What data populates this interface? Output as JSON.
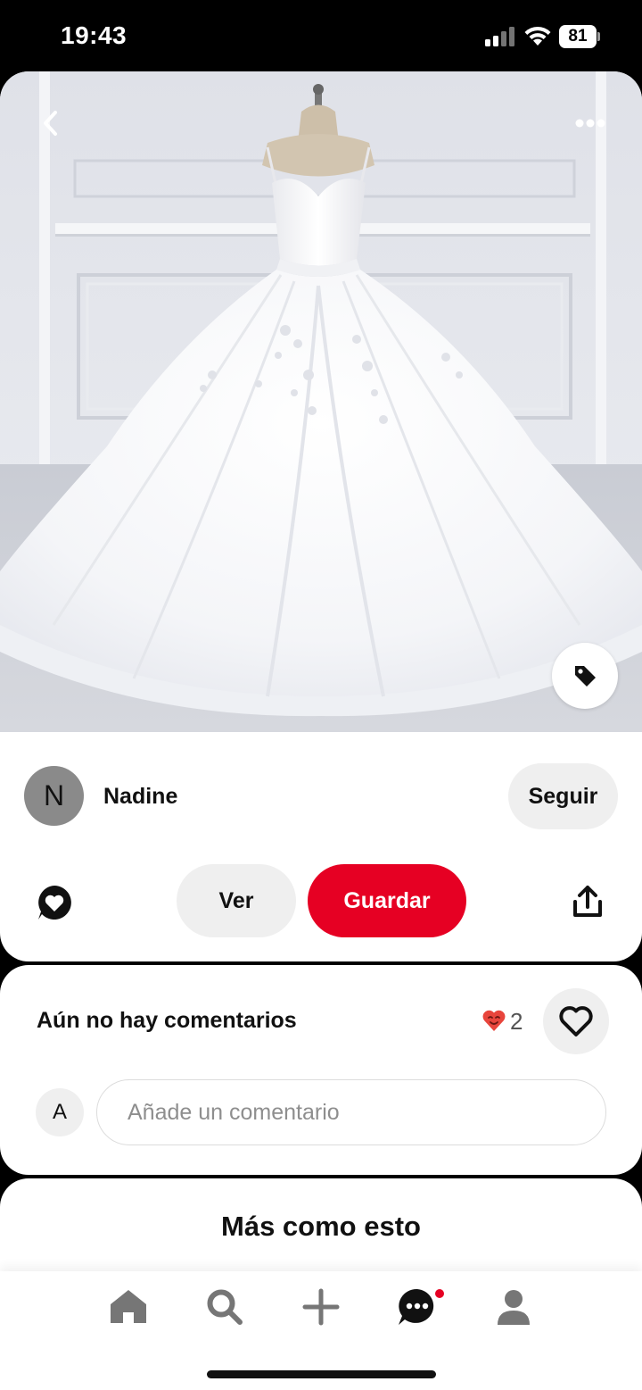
{
  "status_bar": {
    "time": "19:43",
    "battery": "81"
  },
  "pin": {
    "author_initial": "N",
    "author_name": "Nadine",
    "follow_label": "Seguir",
    "view_label": "Ver",
    "save_label": "Guardar"
  },
  "comments": {
    "title": "Aún no hay comentarios",
    "reaction_count": "2",
    "user_initial": "A",
    "input_placeholder": "Añade un comentario"
  },
  "more": {
    "title": "Más como esto"
  },
  "tab_bar": {
    "items": [
      "home-icon",
      "search-icon",
      "plus-icon",
      "messages-icon",
      "profile-icon"
    ]
  },
  "colors": {
    "brand_red": "#e60023",
    "button_gray": "#efefef"
  }
}
